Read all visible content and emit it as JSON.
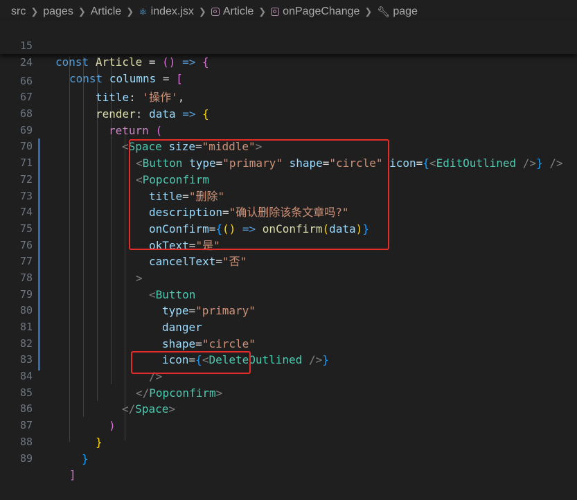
{
  "breadcrumb": {
    "segments": [
      "src",
      "pages",
      "Article",
      "index.jsx",
      "Article",
      "onPageChange",
      "page"
    ]
  },
  "sticky_lines": [
    {
      "number": "15"
    },
    {
      "number": "24"
    }
  ],
  "lines": [
    {
      "number": "66"
    },
    {
      "number": "67"
    },
    {
      "number": "68"
    },
    {
      "number": "69"
    },
    {
      "number": "70"
    },
    {
      "number": "71"
    },
    {
      "number": "72"
    },
    {
      "number": "73"
    },
    {
      "number": "74"
    },
    {
      "number": "75"
    },
    {
      "number": "76"
    },
    {
      "number": "77"
    },
    {
      "number": "78"
    },
    {
      "number": "79"
    },
    {
      "number": "80"
    },
    {
      "number": "81"
    },
    {
      "number": "82"
    },
    {
      "number": "83"
    },
    {
      "number": "84"
    },
    {
      "number": "85"
    },
    {
      "number": "86"
    },
    {
      "number": "87"
    },
    {
      "number": "88"
    },
    {
      "number": "89"
    }
  ],
  "code": {
    "sticky_15": {
      "kw": "const",
      "name": "Article",
      "eq": "=",
      "parens": "()",
      "arrow": "=>",
      "brace": "{"
    },
    "sticky_24": {
      "kw": "const",
      "name": "columns",
      "eq": "=",
      "bracket": "["
    },
    "l66": {
      "key": "title",
      "colon": ":",
      "str": "'操作'",
      "comma": ","
    },
    "l67": {
      "key": "render",
      "colon": ":",
      "param": "data",
      "arrow": "=>",
      "brace": "{"
    },
    "l68": {
      "kw": "return",
      "paren": "("
    },
    "l69": {
      "lt": "<",
      "tag": "Space",
      "attr": "size",
      "eq": "=",
      "val": "\"middle\"",
      "gt": ">"
    },
    "l70": {
      "lt": "<",
      "tag": "Button",
      "a1": "type",
      "v1": "\"primary\"",
      "a2": "shape",
      "v2": "\"circle\"",
      "a3": "icon",
      "eq": "=",
      "ob": "{",
      "lt2": "<",
      "tag2": "EditOutlined",
      "sc2": "/>",
      "cb": "}",
      "sc": "/>"
    },
    "l71": {
      "lt": "<",
      "tag": "Popconfirm"
    },
    "l72": {
      "attr": "title",
      "eq": "=",
      "val": "\"删除\""
    },
    "l73": {
      "attr": "description",
      "eq": "=",
      "val": "\"确认删除该条文章吗?\""
    },
    "l74": {
      "attr": "onConfirm",
      "eq": "=",
      "ob": "{",
      "parens": "()",
      "arrow": "=>",
      "fn": "onConfirm",
      "op": "(",
      "arg": "data",
      "cp": ")",
      "cb": "}"
    },
    "l75": {
      "attr": "okText",
      "eq": "=",
      "val": "\"是\""
    },
    "l76": {
      "attr": "cancelText",
      "eq": "=",
      "val": "\"否\""
    },
    "l77": {
      "gt": ">"
    },
    "l78": {
      "lt": "<",
      "tag": "Button"
    },
    "l79": {
      "attr": "type",
      "eq": "=",
      "val": "\"primary\""
    },
    "l80": {
      "attr": "danger"
    },
    "l81": {
      "attr": "shape",
      "eq": "=",
      "val": "\"circle\""
    },
    "l82": {
      "attr": "icon",
      "eq": "=",
      "ob": "{",
      "lt": "<",
      "tag": "DeleteOutlined",
      "sc": "/>",
      "cb": "}"
    },
    "l83": {
      "sc": "/>"
    },
    "l84": {
      "lt": "</",
      "tag": "Popconfirm",
      "gt": ">"
    },
    "l85": {
      "lt": "</",
      "tag": "Space",
      "gt": ">"
    },
    "l86": {
      "paren": ")"
    },
    "l87": {
      "brace": "}"
    },
    "l88": {
      "brace": "}"
    },
    "l89": {
      "bracket": "]"
    }
  },
  "colors": {
    "background": "#1f1f1f",
    "highlight_border": "#e62b2b",
    "keyword": "#569cd6",
    "tag": "#4ec9b0",
    "attribute": "#9cdcfe",
    "string": "#ce9178",
    "function": "#dcdcaa",
    "control": "#c586c0"
  },
  "icons": [
    "react-file-icon",
    "symbol-method-icon",
    "wrench-icon",
    "chevron-right-icon"
  ]
}
